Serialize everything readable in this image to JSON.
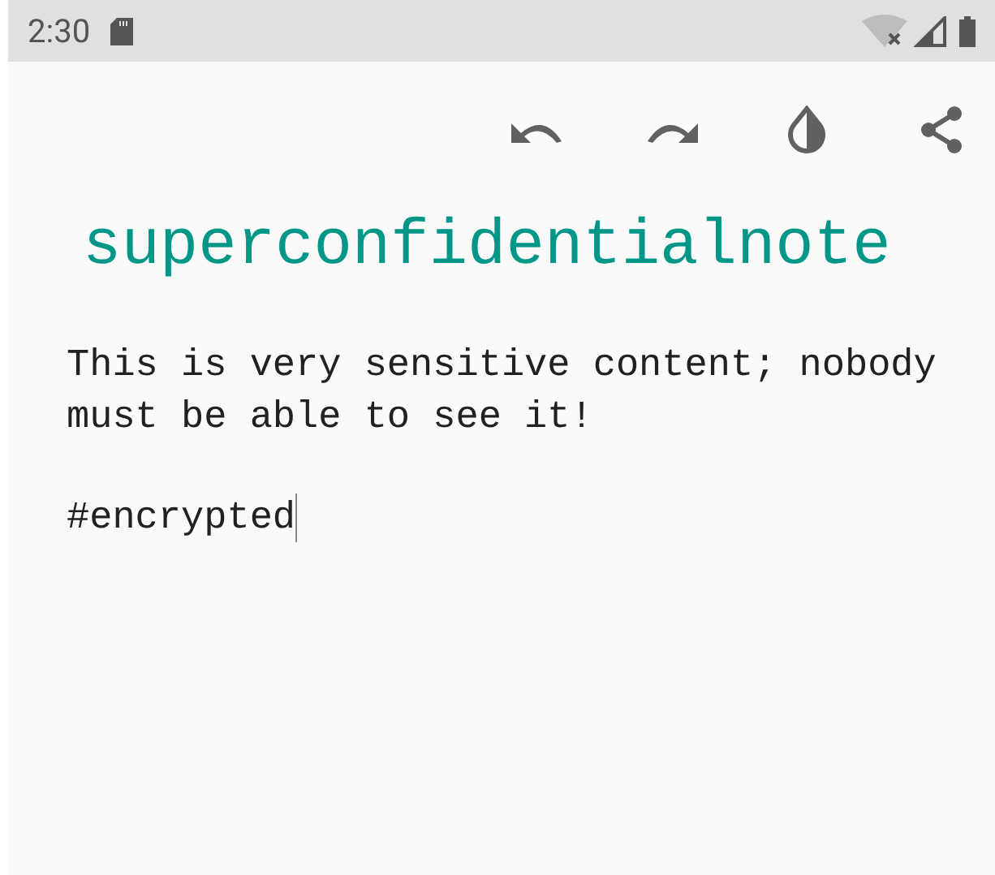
{
  "status_bar": {
    "time": "2:30"
  },
  "note": {
    "title": "superconfidentialnote",
    "paragraphs": [
      "This is very sensitive content; nobody must be able to see it!",
      "#encrypted"
    ],
    "caret": true
  }
}
